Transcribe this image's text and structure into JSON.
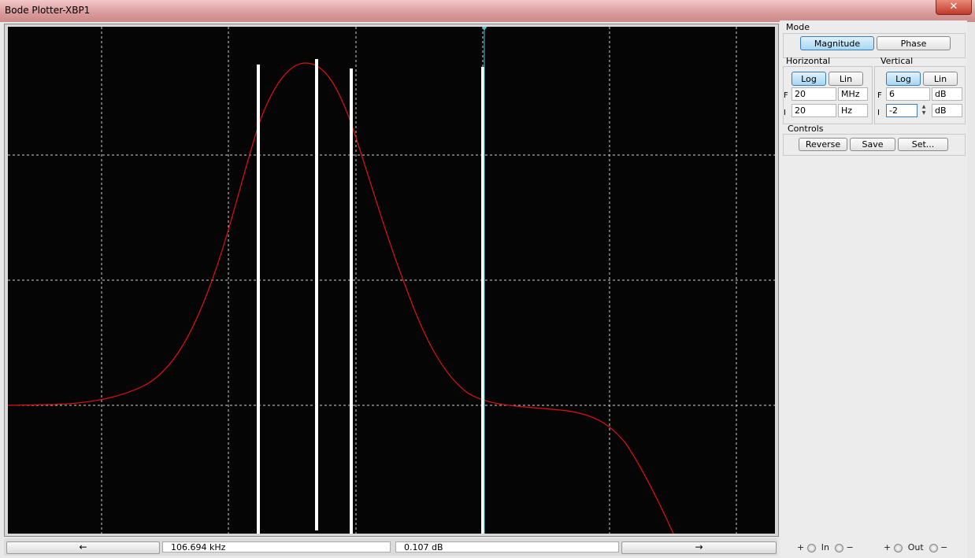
{
  "window": {
    "title": "Bode Plotter-XBP1",
    "close_label": "✕"
  },
  "mode": {
    "label": "Mode",
    "magnitude_label": "Magnitude",
    "phase_label": "Phase",
    "selected": "Magnitude"
  },
  "horizontal": {
    "label": "Horizontal",
    "log_label": "Log",
    "lin_label": "Lin",
    "selected": "Log",
    "final_prefix": "F",
    "final_value": "20",
    "final_unit": "MHz",
    "initial_prefix": "I",
    "initial_value": "20",
    "initial_unit": "Hz"
  },
  "vertical": {
    "label": "Vertical",
    "log_label": "Log",
    "lin_label": "Lin",
    "selected": "Log",
    "final_prefix": "F",
    "final_value": "6",
    "final_unit": "dB",
    "initial_prefix": "I",
    "initial_value": "-2",
    "initial_unit": "dB"
  },
  "controls": {
    "label": "Controls",
    "reverse_label": "Reverse",
    "save_label": "Save",
    "set_label": "Set..."
  },
  "status": {
    "left_arrow": "←",
    "right_arrow": "→",
    "frequency_readout": "106.694 kHz",
    "magnitude_readout": "0.107 dB"
  },
  "terminals": {
    "in_plus": "+",
    "in_label": "In",
    "in_minus": "−",
    "out_plus": "+",
    "out_label": "Out",
    "out_minus": "−"
  },
  "colors": {
    "trace": "#e01010",
    "plot_bg": "#050505",
    "grid": "#cfcfcf",
    "cursor": "#4fc3d6",
    "active_button": "#a8d6f2"
  }
}
